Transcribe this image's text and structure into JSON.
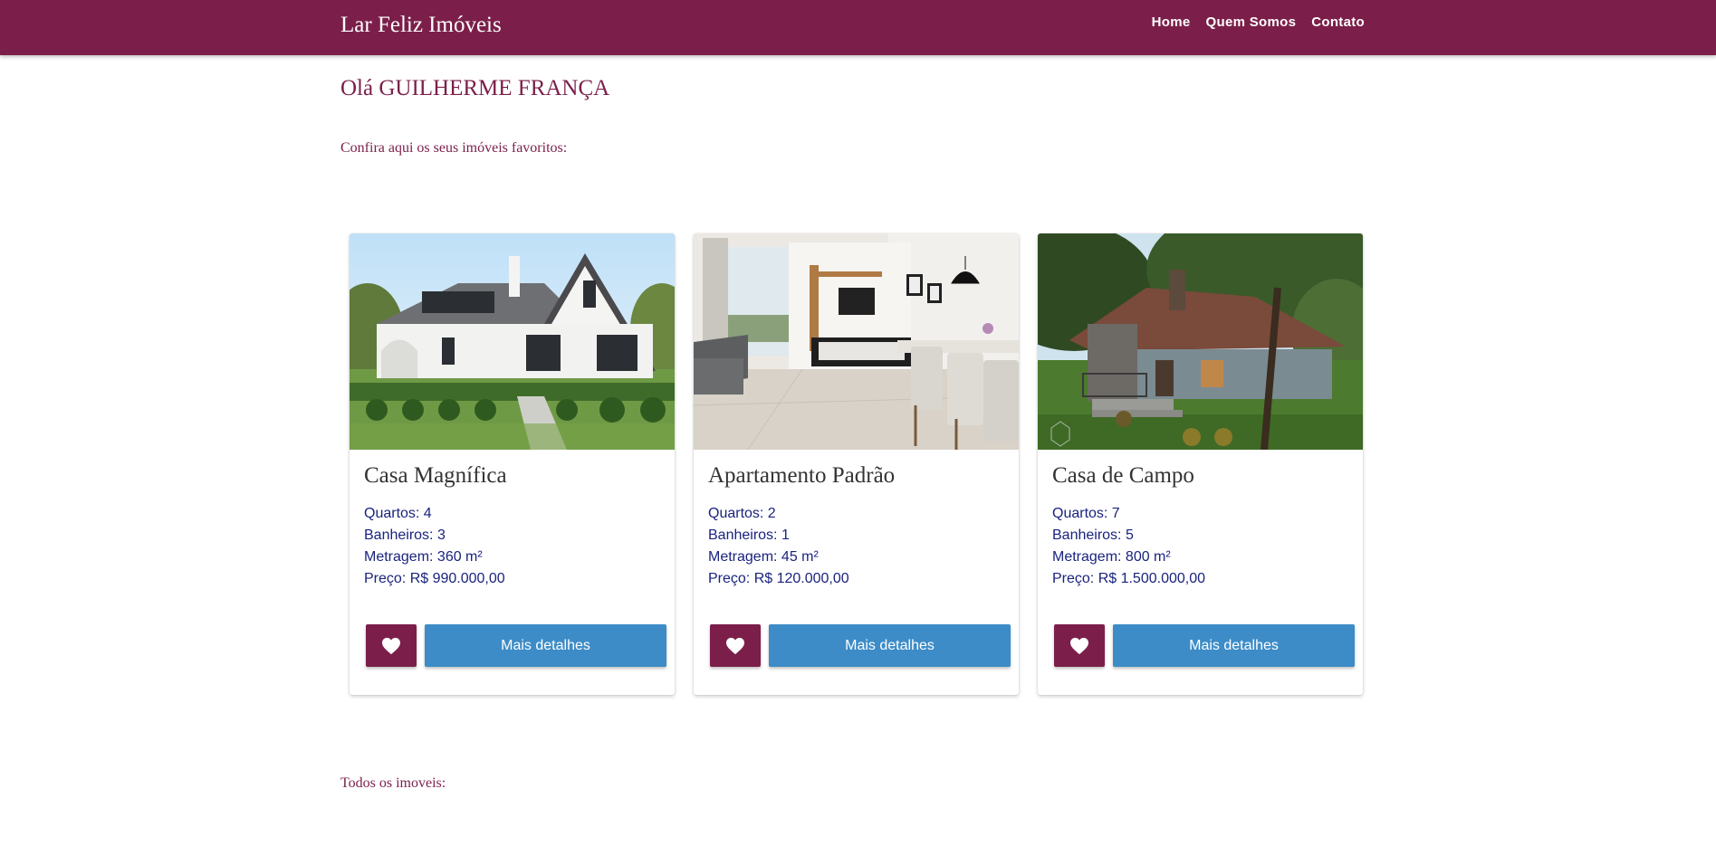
{
  "navbar": {
    "brand": "Lar Feliz Imóveis",
    "links": [
      "Home",
      "Quem Somos",
      "Contato"
    ]
  },
  "greeting": "Olá GUILHERME FRANÇA",
  "favorites_intro": "Confira aqui os seus imóveis favoritos:",
  "cards": [
    {
      "title": "Casa Magnífica",
      "image": "house-photo",
      "rooms": "Quartos: 4",
      "bathrooms": "Banheiros: 3",
      "area": "Metragem: 360 m²",
      "price": "Preço: R$ 990.000,00",
      "favorite_icon": "heart-icon",
      "details_label": "Mais detalhes"
    },
    {
      "title": "Apartamento Padrão",
      "image": "apartment-photo",
      "rooms": "Quartos: 2",
      "bathrooms": "Banheiros: 1",
      "area": "Metragem: 45 m²",
      "price": "Preço: R$ 120.000,00",
      "favorite_icon": "heart-icon",
      "details_label": "Mais detalhes"
    },
    {
      "title": "Casa de Campo",
      "image": "country-house-photo",
      "rooms": "Quartos: 7",
      "bathrooms": "Banheiros: 5",
      "area": "Metragem: 800 m²",
      "price": "Preço: R$ 1.500.000,00",
      "favorite_icon": "heart-icon",
      "details_label": "Mais detalhes"
    }
  ],
  "all_listings_title": "Todos os imoveis:",
  "colors": {
    "primary": "#7b1f4a",
    "button_blue": "#3d8cc7",
    "info_text": "#1a237e",
    "title_text": "#333333"
  }
}
